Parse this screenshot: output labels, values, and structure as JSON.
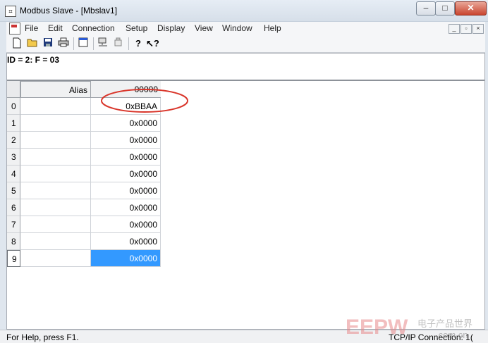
{
  "window": {
    "title": "Modbus Slave - [Mbslav1]",
    "controls": {
      "minimize": "‒",
      "maximize": "□",
      "close": "✕"
    }
  },
  "menu": {
    "items": [
      "File",
      "Edit",
      "Connection",
      "Setup",
      "Display",
      "View",
      "Window",
      "Help"
    ],
    "mdi_controls": {
      "minimize": "_",
      "restore": "▫",
      "close": "×"
    }
  },
  "toolbar": {
    "icons": [
      "new-icon",
      "open-icon",
      "save-icon",
      "print-icon",
      "window-icon",
      "connect-icon",
      "disconnect-icon",
      "help-icon",
      "context-help-icon"
    ]
  },
  "document": {
    "id_line": "ID = 2: F = 03",
    "grid": {
      "alias_header": "Alias",
      "address_header": "00000",
      "rows": [
        {
          "num": "0",
          "value": "0xBBAA"
        },
        {
          "num": "1",
          "value": "0x0000"
        },
        {
          "num": "2",
          "value": "0x0000"
        },
        {
          "num": "3",
          "value": "0x0000"
        },
        {
          "num": "4",
          "value": "0x0000"
        },
        {
          "num": "5",
          "value": "0x0000"
        },
        {
          "num": "6",
          "value": "0x0000"
        },
        {
          "num": "7",
          "value": "0x0000"
        },
        {
          "num": "8",
          "value": "0x0000"
        },
        {
          "num": "9",
          "value": "0x0000"
        }
      ],
      "selected_row": 9,
      "selection_color": "#3399ff"
    },
    "annotation_color": "#d9362b"
  },
  "status": {
    "left": "For Help, press F1.",
    "right": "TCP/IP Connection: 1("
  },
  "watermark": {
    "text": "EEPW",
    "cn_text": "电子产品世界",
    "domain": ".com.cn"
  }
}
